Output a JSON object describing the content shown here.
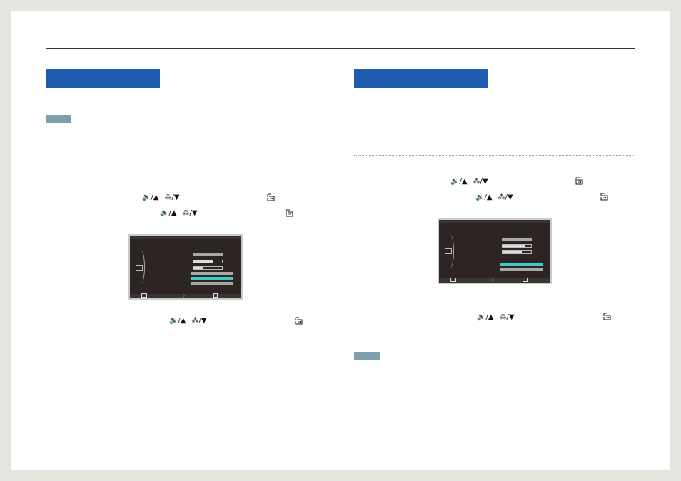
{
  "icons": {
    "volume_up": "🔉/▲",
    "bright_down": "⁂/▼",
    "separator": "~"
  },
  "colors": {
    "heading_bar": "#1e5aad",
    "note_tag": "#7f9fac",
    "osd_background": "#2d2523",
    "osd_highlight": "#41c8c8"
  }
}
